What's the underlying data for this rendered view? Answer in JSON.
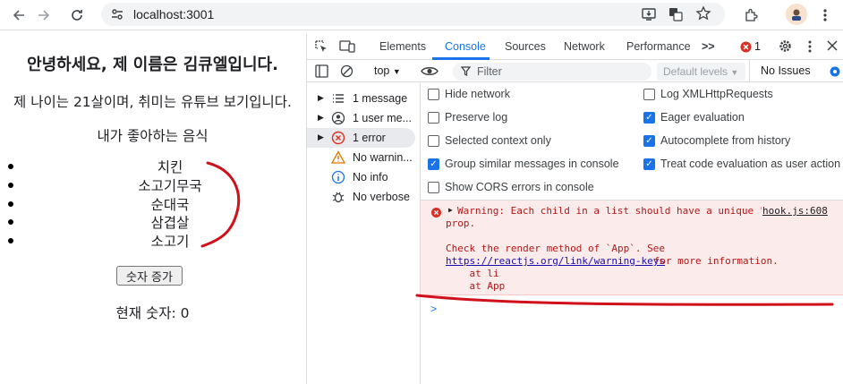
{
  "browser": {
    "url": "localhost:3001"
  },
  "page": {
    "heading": "안녕하세요, 제 이름은 김큐엘입니다.",
    "intro": "제 나이는 21살이며, 취미는 유튜브 보기입니다.",
    "foods_title": "내가 좋아하는 음식",
    "foods": [
      "치킨",
      "소고기무국",
      "순대국",
      "삼겹살",
      "소고기"
    ],
    "increment_button": "숫자 증가",
    "current_number": "현재 숫자: 0"
  },
  "devtools": {
    "tabs": [
      "Elements",
      "Console",
      "Sources",
      "Network",
      "Performance"
    ],
    "more_tabs": ">>",
    "error_count": "1",
    "context": "top",
    "filter_placeholder": "Filter",
    "default_levels": "Default levels",
    "issues": "No Issues",
    "sidebar": [
      {
        "label": "1 message",
        "icon": "list-icon"
      },
      {
        "label": "1 user me...",
        "icon": "user-icon"
      },
      {
        "label": "1 error",
        "icon": "error-icon"
      },
      {
        "label": "No warnin...",
        "icon": "warning-icon"
      },
      {
        "label": "No info",
        "icon": "info-icon"
      },
      {
        "label": "No verbose",
        "icon": "bug-icon"
      }
    ],
    "settings_left": [
      {
        "label": "Hide network",
        "checked": false
      },
      {
        "label": "Preserve log",
        "checked": false
      },
      {
        "label": "Selected context only",
        "checked": false
      },
      {
        "label": "Group similar messages in console",
        "checked": true
      },
      {
        "label": "Show CORS errors in console",
        "checked": false
      }
    ],
    "settings_right": [
      {
        "label": "Log XMLHttpRequests",
        "checked": false
      },
      {
        "label": "Eager evaluation",
        "checked": true
      },
      {
        "label": "Autocomplete from history",
        "checked": true
      },
      {
        "label": "Treat code evaluation as user action",
        "checked": true
      }
    ],
    "error": {
      "line1": "Warning: Each child in a list should have a unique \"key\"",
      "source": "hook.js:608",
      "line2": "prop.",
      "line3": "Check the render method of `App`. See",
      "link": "https://reactjs.org/link/warning-keys",
      "line4_rest": " for more information.",
      "at1": "    at li",
      "at2": "    at App"
    },
    "prompt": ">"
  },
  "annotation_color": "#d0101a"
}
